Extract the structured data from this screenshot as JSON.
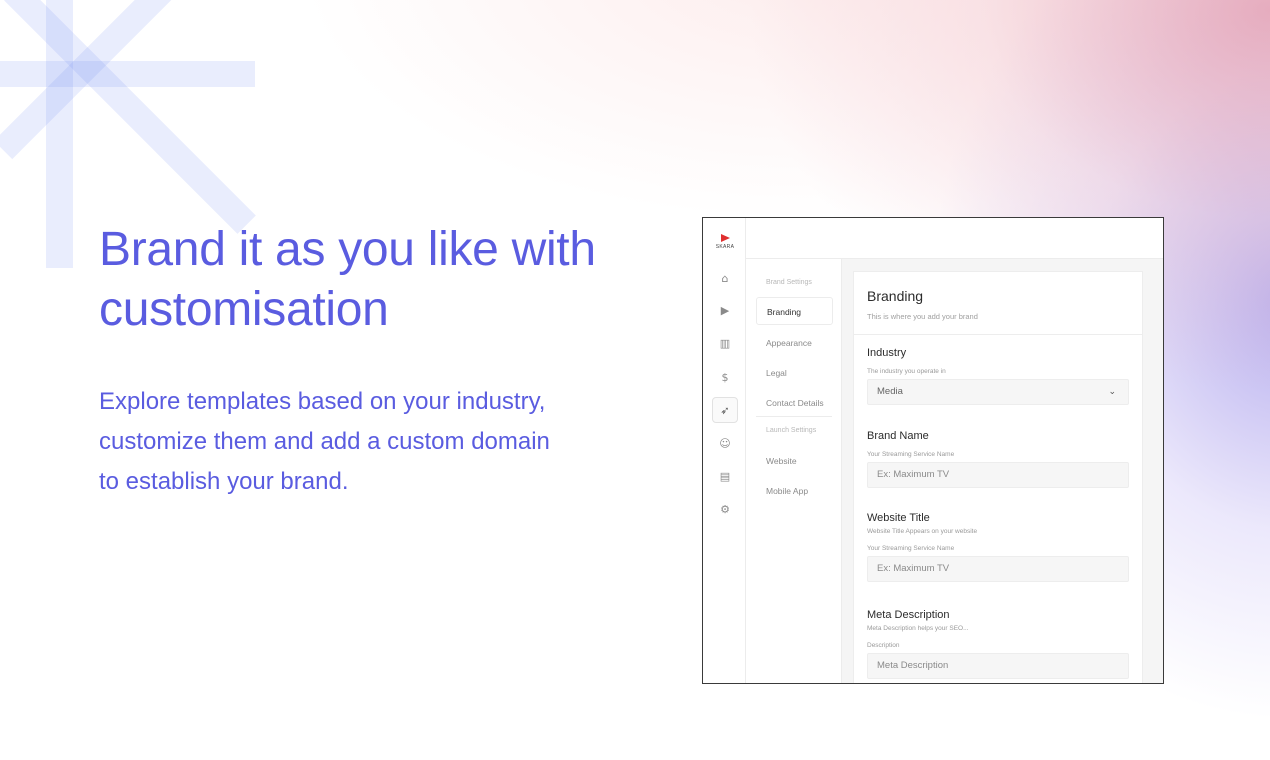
{
  "hero": {
    "title_line1": "Brand it as you like with",
    "title_line2": "customisation",
    "description_line1": "Explore templates based on your industry,",
    "description_line2": "customize them and add a custom domain",
    "description_line3": "to establish your brand."
  },
  "app": {
    "logo_text": "SKARA",
    "rail_icons": [
      "home-icon",
      "video-icon",
      "analytics-icon",
      "dollar-icon",
      "rocket-icon",
      "users-icon",
      "building-icon",
      "settings-icon"
    ],
    "subnav": {
      "brand_settings_heading": "Brand Settings",
      "items": [
        "Branding",
        "Appearance",
        "Legal",
        "Contact Details"
      ],
      "launch_settings_heading": "Launch Settings",
      "launch_items": [
        "Website",
        "Mobile App"
      ]
    },
    "card": {
      "title": "Branding",
      "subtitle": "This is where you add your brand",
      "industry": {
        "label": "Industry",
        "hint": "The industry you operate in",
        "value": "Media"
      },
      "brand_name": {
        "label": "Brand Name",
        "hint": "Your Streaming Service Name",
        "placeholder": "Ex: Maximum TV"
      },
      "website_title": {
        "label": "Website Title",
        "hint": "Website Title Appears on your website",
        "hint2": "Your Streaming Service Name",
        "placeholder": "Ex: Maximum TV"
      },
      "meta_description": {
        "label": "Meta Description",
        "hint": "Meta Description helps your SEO...",
        "hint2": "Description",
        "placeholder": "Meta Description"
      }
    }
  },
  "colors": {
    "accent": "#5a5ce0",
    "logo_flag": "#e03030"
  }
}
